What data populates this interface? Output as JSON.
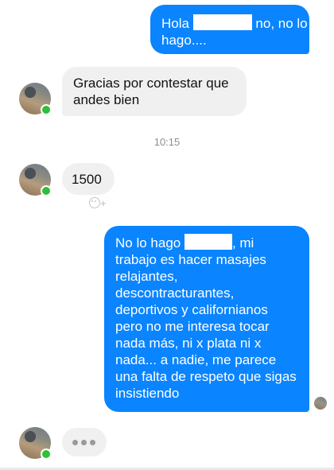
{
  "messages": [
    {
      "direction": "out",
      "line1_prefix": "Hola ",
      "line1_suffix": " no, no lo",
      "line2": "hago...."
    },
    {
      "direction": "in",
      "text": "Gracias por contestar que andes bien"
    },
    {
      "direction": "in",
      "text": "1500"
    },
    {
      "direction": "out",
      "prefix": "No lo hago ",
      "after_redaction": ", mi",
      "rest": "trabajo es hacer masajes relajantes, descontracturantes, deportivos y californianos pero no me interesa tocar nada más, ni x plata ni x nada... a nadie, me parece una falta de respeto que sigas insistiendo"
    }
  ],
  "timestamp": "10:15",
  "reaction_button": {
    "icon": "smiley-add-icon",
    "plus": "+"
  },
  "typing_indicator": {
    "dots": 3
  },
  "colors": {
    "outgoing_bubble": "#0a84ff",
    "incoming_bubble": "#f1f0f0",
    "online_status": "#2fbf3a"
  }
}
